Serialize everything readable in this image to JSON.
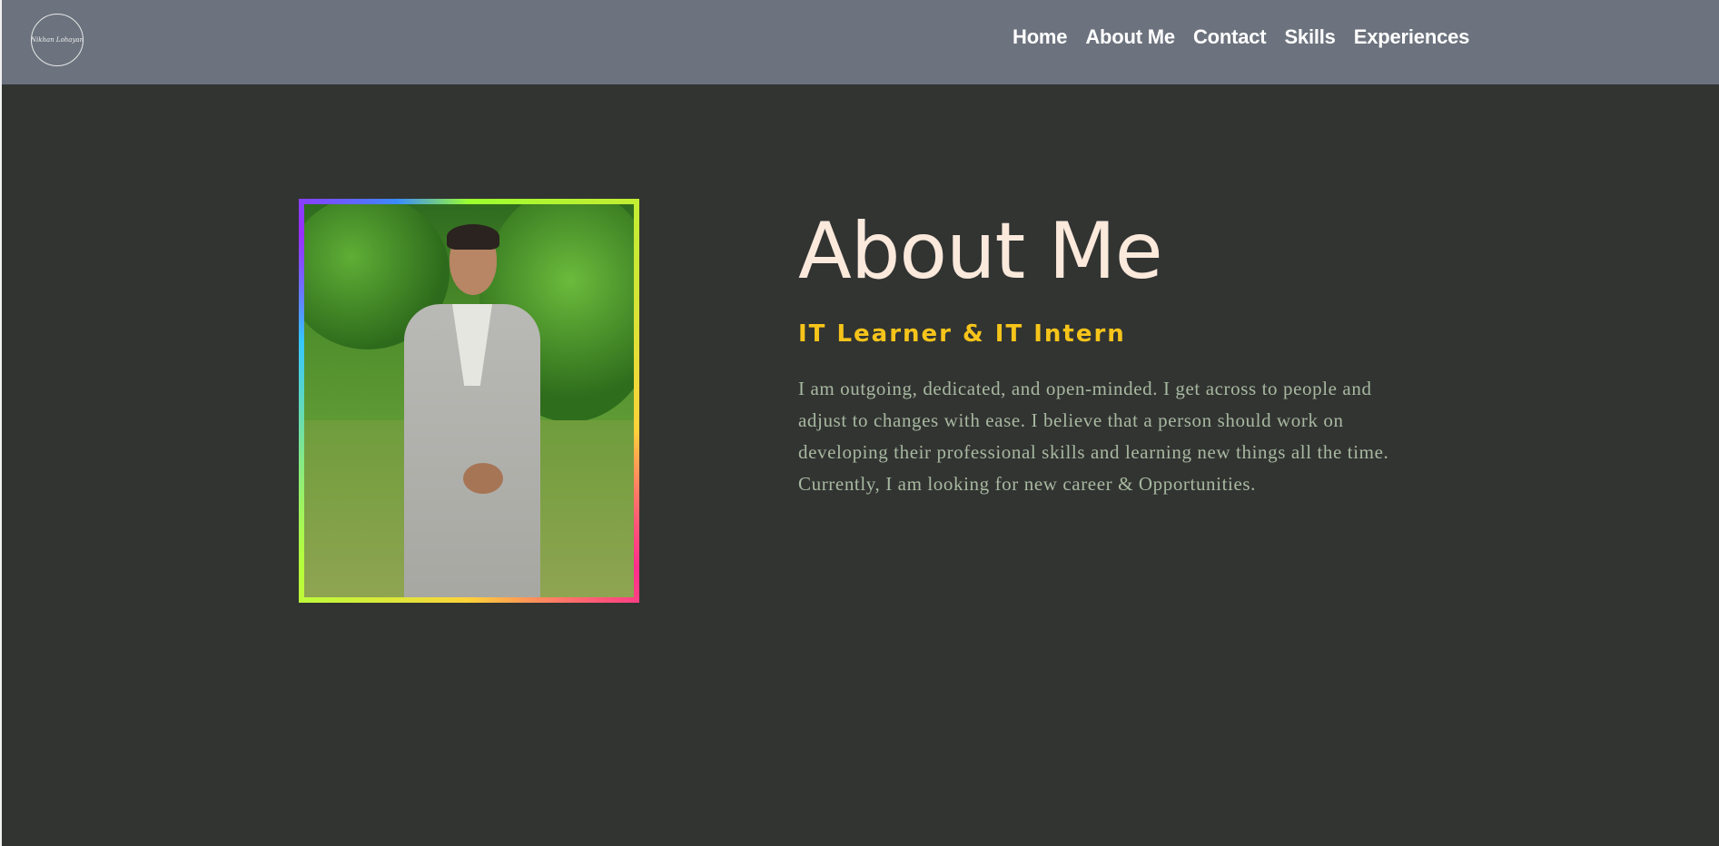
{
  "header": {
    "logo_text": "Nikhan Lohayan",
    "nav": [
      {
        "label": "Home"
      },
      {
        "label": "About Me"
      },
      {
        "label": "Contact"
      },
      {
        "label": "Skills"
      },
      {
        "label": "Experiences"
      }
    ]
  },
  "about": {
    "title": "About Me",
    "subtitle": "IT Learner & IT Intern",
    "description": "I am outgoing, dedicated, and open-minded. I get across to people and adjust to changes with ease. I believe that a person should work on developing their professional skills and learning new things all the time. Currently, I am looking for new career & Opportunities.",
    "photo_alt": "portrait photo"
  },
  "colors": {
    "navbar": "#6c737e",
    "background": "#323432",
    "title": "#fbe9dc",
    "subtitle": "#f6c41a",
    "description": "#a8b8a0"
  }
}
